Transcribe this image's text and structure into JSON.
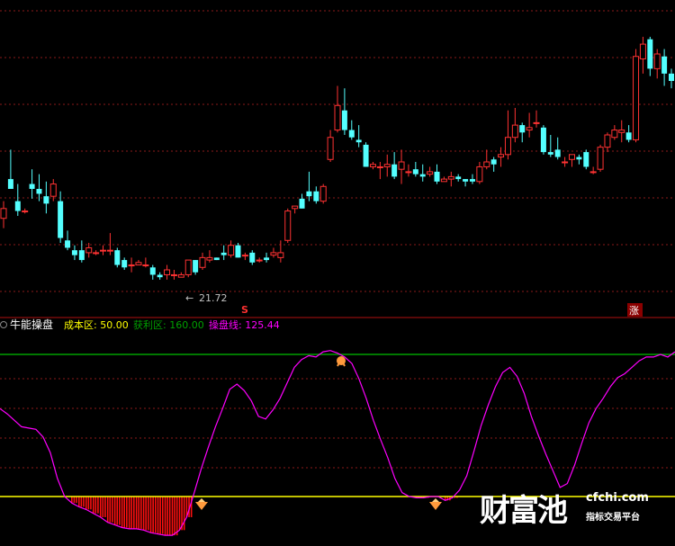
{
  "colors": {
    "up": "#ff3232",
    "down": "#54ffff",
    "grid": "#8b1a1a",
    "cost_line": "#ffff00",
    "profit_line": "#00a000",
    "operation_line": "#ff00ff",
    "bar": "#ff1010"
  },
  "price_panel": {
    "min_price_label": "21.72",
    "marker_s": "S",
    "marker_zhang": "涨"
  },
  "indicator_header": {
    "title": "牛能操盘",
    "cost_label": "成本区: 50.00",
    "profit_label": "获利区: 160.00",
    "operation_label": "操盘线: 125.44"
  },
  "watermark": {
    "logo": "财富池",
    "url": "cfchi.com",
    "sub": "指标交易平台"
  },
  "chart_data": [
    {
      "type": "candlestick",
      "x": [
        1,
        2,
        3,
        4,
        5,
        6,
        7,
        8,
        9,
        10,
        11,
        12,
        13,
        14,
        15,
        16,
        17,
        18,
        19,
        20,
        21,
        22,
        23,
        24,
        25,
        26,
        27,
        28,
        29,
        30,
        31,
        32,
        33,
        34,
        35,
        36,
        37,
        38,
        39,
        40,
        41,
        42,
        43,
        44,
        45,
        46,
        47,
        48,
        49,
        50,
        51,
        52,
        53,
        54,
        55,
        56,
        57,
        58,
        59,
        60,
        61,
        62,
        63,
        64,
        65,
        66,
        67,
        68,
        69,
        70,
        71,
        72,
        73,
        74,
        75,
        76,
        77,
        78,
        79,
        80,
        81,
        82,
        83,
        84,
        85,
        86,
        87,
        88,
        89,
        90,
        91,
        92,
        93,
        94,
        95
      ],
      "ohlc": [
        [
          24.2,
          24.9,
          23.8,
          24.6
        ],
        [
          25.8,
          27.0,
          25.4,
          25.4
        ],
        [
          24.9,
          25.6,
          24.3,
          24.5
        ],
        [
          24.5,
          24.6,
          24.4,
          24.5
        ],
        [
          25.6,
          26.2,
          25.0,
          25.4
        ],
        [
          25.4,
          26.0,
          24.9,
          25.2
        ],
        [
          25.1,
          25.7,
          24.4,
          24.8
        ],
        [
          25.1,
          25.8,
          24.9,
          25.6
        ],
        [
          24.9,
          25.3,
          23.2,
          23.4
        ],
        [
          23.3,
          23.7,
          22.9,
          23.0
        ],
        [
          22.9,
          23.1,
          22.5,
          22.7
        ],
        [
          22.9,
          23.3,
          22.4,
          22.5
        ],
        [
          22.8,
          23.2,
          22.6,
          23.0
        ],
        [
          22.8,
          22.9,
          22.7,
          22.8
        ],
        [
          22.9,
          23.1,
          22.7,
          22.9
        ],
        [
          22.9,
          23.6,
          22.7,
          22.9
        ],
        [
          22.9,
          23.0,
          22.2,
          22.3
        ],
        [
          22.5,
          22.6,
          22.1,
          22.2
        ],
        [
          22.3,
          22.6,
          22.0,
          22.3
        ],
        [
          22.3,
          22.5,
          22.3,
          22.4
        ],
        [
          22.3,
          22.6,
          22.2,
          22.3
        ],
        [
          22.2,
          22.3,
          21.7,
          21.9
        ],
        [
          21.9,
          22.0,
          21.7,
          21.8
        ],
        [
          21.9,
          22.3,
          21.7,
          22.1
        ],
        [
          21.9,
          22.1,
          21.7,
          21.9
        ],
        [
          21.8,
          22.0,
          21.8,
          21.9
        ],
        [
          21.9,
          22.5,
          21.8,
          22.5
        ],
        [
          22.5,
          22.5,
          21.9,
          22.0
        ],
        [
          22.2,
          22.8,
          22.1,
          22.6
        ],
        [
          22.5,
          22.9,
          22.4,
          22.6
        ],
        [
          22.6,
          22.6,
          22.5,
          22.5
        ],
        [
          22.8,
          23.1,
          22.5,
          22.7
        ],
        [
          22.7,
          23.3,
          22.6,
          23.1
        ],
        [
          23.1,
          23.2,
          22.6,
          22.6
        ],
        [
          22.7,
          22.8,
          22.5,
          22.7
        ],
        [
          22.8,
          22.9,
          22.3,
          22.4
        ],
        [
          22.5,
          22.6,
          22.4,
          22.5
        ],
        [
          22.6,
          22.8,
          22.4,
          22.5
        ],
        [
          22.7,
          23.0,
          22.6,
          22.8
        ],
        [
          22.6,
          23.3,
          22.4,
          22.8
        ],
        [
          23.3,
          24.6,
          23.2,
          24.5
        ],
        [
          24.6,
          24.7,
          24.4,
          24.7
        ],
        [
          25.0,
          25.2,
          24.6,
          24.6
        ],
        [
          25.3,
          26.1,
          24.9,
          25.1
        ],
        [
          25.3,
          25.5,
          24.8,
          24.9
        ],
        [
          24.9,
          25.6,
          24.8,
          25.5
        ],
        [
          26.6,
          27.8,
          26.5,
          27.5
        ],
        [
          27.8,
          29.6,
          27.7,
          28.8
        ],
        [
          28.6,
          29.5,
          27.6,
          27.8
        ],
        [
          27.8,
          28.2,
          27.4,
          27.5
        ],
        [
          27.4,
          28.0,
          27.1,
          27.3
        ],
        [
          27.2,
          27.3,
          26.3,
          26.3
        ],
        [
          26.3,
          26.5,
          26.2,
          26.4
        ],
        [
          26.3,
          26.5,
          25.8,
          26.3
        ],
        [
          26.3,
          26.8,
          25.9,
          26.4
        ],
        [
          26.4,
          26.9,
          25.8,
          25.9
        ],
        [
          26.2,
          27.0,
          25.6,
          26.5
        ],
        [
          26.1,
          26.4,
          25.9,
          26.1
        ],
        [
          26.2,
          26.5,
          25.9,
          26.0
        ],
        [
          26.0,
          26.4,
          25.7,
          25.9
        ],
        [
          26.0,
          26.3,
          25.9,
          26.1
        ],
        [
          26.1,
          26.4,
          25.6,
          25.7
        ],
        [
          25.7,
          25.9,
          25.7,
          25.8
        ],
        [
          25.8,
          26.1,
          25.5,
          25.9
        ],
        [
          25.9,
          26.0,
          25.7,
          25.8
        ],
        [
          25.8,
          25.8,
          25.5,
          25.7
        ],
        [
          25.8,
          26.0,
          25.6,
          25.7
        ],
        [
          25.7,
          26.5,
          25.6,
          26.3
        ],
        [
          26.3,
          27.0,
          26.2,
          26.5
        ],
        [
          26.6,
          26.7,
          26.1,
          26.4
        ],
        [
          26.7,
          27.1,
          26.3,
          26.8
        ],
        [
          26.8,
          28.6,
          26.6,
          27.5
        ],
        [
          27.5,
          28.7,
          27.3,
          28.0
        ],
        [
          28.0,
          28.1,
          27.3,
          27.7
        ],
        [
          27.8,
          28.5,
          27.5,
          27.9
        ],
        [
          28.1,
          28.6,
          27.9,
          28.1
        ],
        [
          27.9,
          28.0,
          26.8,
          26.9
        ],
        [
          26.9,
          27.6,
          26.7,
          26.8
        ],
        [
          27.0,
          27.5,
          26.6,
          26.7
        ],
        [
          26.5,
          26.7,
          26.3,
          26.5
        ],
        [
          26.6,
          26.8,
          26.3,
          26.8
        ],
        [
          26.7,
          26.8,
          26.4,
          26.6
        ],
        [
          26.9,
          27.0,
          26.2,
          26.3
        ],
        [
          26.1,
          26.3,
          26.0,
          26.1
        ],
        [
          26.2,
          27.2,
          26.1,
          27.1
        ],
        [
          27.1,
          27.7,
          26.9,
          27.6
        ],
        [
          27.5,
          28.0,
          27.4,
          27.8
        ],
        [
          27.7,
          28.2,
          27.3,
          27.8
        ],
        [
          27.7,
          28.0,
          27.3,
          27.4
        ],
        [
          27.4,
          31.1,
          27.3,
          30.8
        ],
        [
          30.7,
          31.6,
          30.1,
          31.3
        ],
        [
          31.5,
          31.6,
          30.0,
          30.3
        ],
        [
          30.3,
          31.1,
          29.9,
          30.9
        ],
        [
          30.8,
          31.1,
          29.6,
          30.1
        ],
        [
          30.1,
          30.3,
          29.5,
          29.8
        ]
      ],
      "min_label": "21.72"
    },
    {
      "type": "line",
      "title": "牛能操盘",
      "series": [
        {
          "name": "成本区",
          "values": [
            50,
            50,
            50,
            50,
            50,
            50,
            50,
            50,
            50,
            50,
            50,
            50,
            50,
            50,
            50,
            50,
            50,
            50,
            50,
            50,
            50,
            50,
            50,
            50,
            50,
            50,
            50,
            50,
            50,
            50,
            50,
            50,
            50,
            50,
            50,
            50,
            50,
            50,
            50,
            50,
            50,
            50,
            50,
            50,
            50,
            50,
            50,
            50,
            50,
            50,
            50,
            50,
            50,
            50,
            50,
            50,
            50,
            50,
            50,
            50,
            50,
            50,
            50,
            50,
            50,
            50,
            50,
            50,
            50,
            50,
            50,
            50,
            50,
            50,
            50,
            50,
            50,
            50,
            50,
            50,
            50,
            50,
            50,
            50,
            50,
            50,
            50,
            50,
            50,
            50,
            50,
            50,
            50,
            50,
            50
          ]
        },
        {
          "name": "获利区",
          "values": [
            160,
            160,
            160,
            160,
            160,
            160,
            160,
            160,
            160,
            160,
            160,
            160,
            160,
            160,
            160,
            160,
            160,
            160,
            160,
            160,
            160,
            160,
            160,
            160,
            160,
            160,
            160,
            160,
            160,
            160,
            160,
            160,
            160,
            160,
            160,
            160,
            160,
            160,
            160,
            160,
            160,
            160,
            160,
            160,
            160,
            160,
            160,
            160,
            160,
            160,
            160,
            160,
            160,
            160,
            160,
            160,
            160,
            160,
            160,
            160,
            160,
            160,
            160,
            160,
            160,
            160,
            160,
            160,
            160,
            160,
            160,
            160,
            160,
            160,
            160,
            160,
            160,
            160,
            160,
            160,
            160,
            160,
            160,
            160,
            160,
            160,
            160,
            160,
            160,
            160,
            160,
            160,
            160,
            160,
            160
          ]
        },
        {
          "name": "操盘线",
          "values": [
            118,
            114,
            109,
            104,
            103,
            102,
            96,
            84,
            64,
            50,
            45,
            42,
            40,
            37,
            34,
            30,
            28,
            26,
            25,
            25,
            24,
            22,
            21,
            20,
            20,
            24,
            34,
            52,
            71,
            88,
            104,
            118,
            133,
            137,
            132,
            124,
            112,
            110,
            117,
            126,
            138,
            150,
            156,
            159,
            158,
            162,
            163,
            161,
            158,
            153,
            141,
            126,
            109,
            94,
            80,
            64,
            53,
            50,
            49,
            49,
            50,
            50,
            47,
            49,
            55,
            66,
            85,
            105,
            121,
            135,
            146,
            150,
            143,
            130,
            112,
            97,
            83,
            70,
            57,
            60,
            74,
            91,
            107,
            118,
            126,
            135,
            142,
            145,
            150,
            155,
            158,
            158,
            160,
            158,
            162
          ]
        }
      ],
      "bars_below_cost": true
    }
  ]
}
